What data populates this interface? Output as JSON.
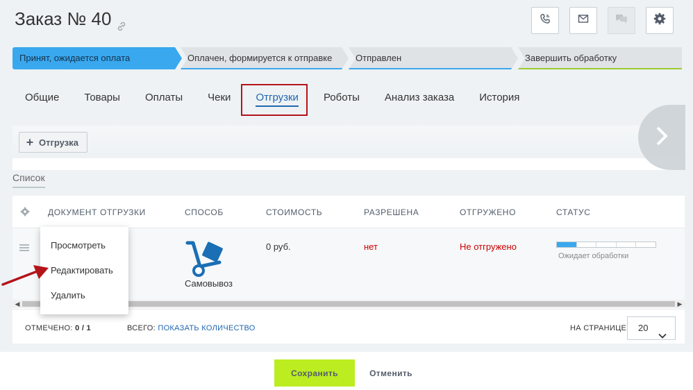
{
  "header": {
    "title": "Заказ № 40",
    "icons": [
      "link-icon",
      "phone-icon",
      "mail-icon",
      "chat-icon",
      "gear-icon"
    ]
  },
  "stages": [
    {
      "label": "Принят, ожидается оплата",
      "color": "#39a8ef",
      "active": true
    },
    {
      "label": "Оплачен, формируется к отправке",
      "color": "#39a8ef"
    },
    {
      "label": "Отправлен",
      "color": "#39a8ef"
    },
    {
      "label": "Завершить обработку",
      "color": "#9bcc2e"
    }
  ],
  "tabs": [
    {
      "label": "Общие"
    },
    {
      "label": "Товары"
    },
    {
      "label": "Оплаты"
    },
    {
      "label": "Чеки"
    },
    {
      "label": "Отгрузки",
      "active": true
    },
    {
      "label": "Роботы"
    },
    {
      "label": "Анализ заказа"
    },
    {
      "label": "История"
    }
  ],
  "toolbar": {
    "add_label": "Отгрузка"
  },
  "list": {
    "label": "Список"
  },
  "grid": {
    "columns": [
      "Документ отгрузки",
      "Способ",
      "Стоимость",
      "Разрешена",
      "Отгружено",
      "Статус"
    ],
    "rows": [
      {
        "method": "Самовывоз",
        "cost": "0 руб.",
        "allowed": "нет",
        "shipped": "Не отгружено",
        "status": "Ожидает обработки",
        "status_progress": 0.2
      }
    ]
  },
  "context_menu": {
    "items": [
      "Просмотреть",
      "Редактировать",
      "Удалить"
    ]
  },
  "footer": {
    "marked_label": "Отмечено:",
    "marked_value": "0 / 1",
    "total_label": "Всего:",
    "total_link": "Показать количество",
    "per_page_label": "На странице:",
    "per_page_value": "20"
  },
  "actions": {
    "save": "Сохранить",
    "cancel": "Отменить"
  },
  "colors": {
    "accent": "#39a8ef",
    "save": "#bbed21",
    "highlight": "#b3141a",
    "link": "#2067b0",
    "error": "#cc0000"
  }
}
